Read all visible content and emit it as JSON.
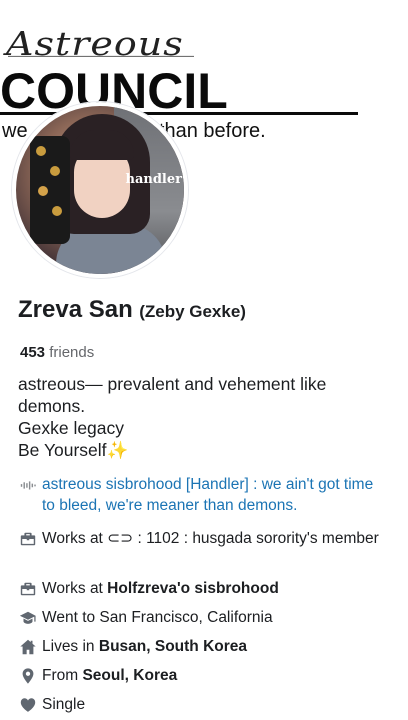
{
  "cover": {
    "script_text": "Astreous",
    "title": "COUNCIL",
    "tagline_left": "we",
    "tagline_right": "er than before."
  },
  "avatar": {
    "sign_text": "handler"
  },
  "profile": {
    "name": "Zreva San",
    "alt_name": "(Zeby Gexke)",
    "friends_count": "453",
    "friends_label": "friends"
  },
  "bio": {
    "line1": "astreous— prevalent and vehement like",
    "line2": "demons.",
    "line3": "Gexke legacy",
    "line4": "Be Yourself",
    "sparkle": "✨"
  },
  "details": {
    "link_text": "astreous sisbrohood [Handler] : we ain't got time to bleed, we're meaner than demons.",
    "work1_prefix": "Works at ",
    "work1_value": "⊂⊃ : 1102 : husgada sorority's member",
    "work2_prefix": "Works at ",
    "work2_value": "Holfzreva'o sisbrohood",
    "education": "Went to San Francisco, California",
    "lives_prefix": "Lives in ",
    "lives_value": "Busan, South Korea",
    "from_prefix": "From ",
    "from_value": "Seoul, Korea",
    "relationship": "Single"
  },
  "icons": {
    "sound": "soundwave-icon",
    "work": "briefcase-icon",
    "education": "graduation-cap-icon",
    "home": "home-icon",
    "location": "location-pin-icon",
    "relationship": "heart-icon"
  },
  "colors": {
    "text": "#1c1e21",
    "muted": "#65676b",
    "link": "#1b74b4",
    "icon": "#606770"
  }
}
